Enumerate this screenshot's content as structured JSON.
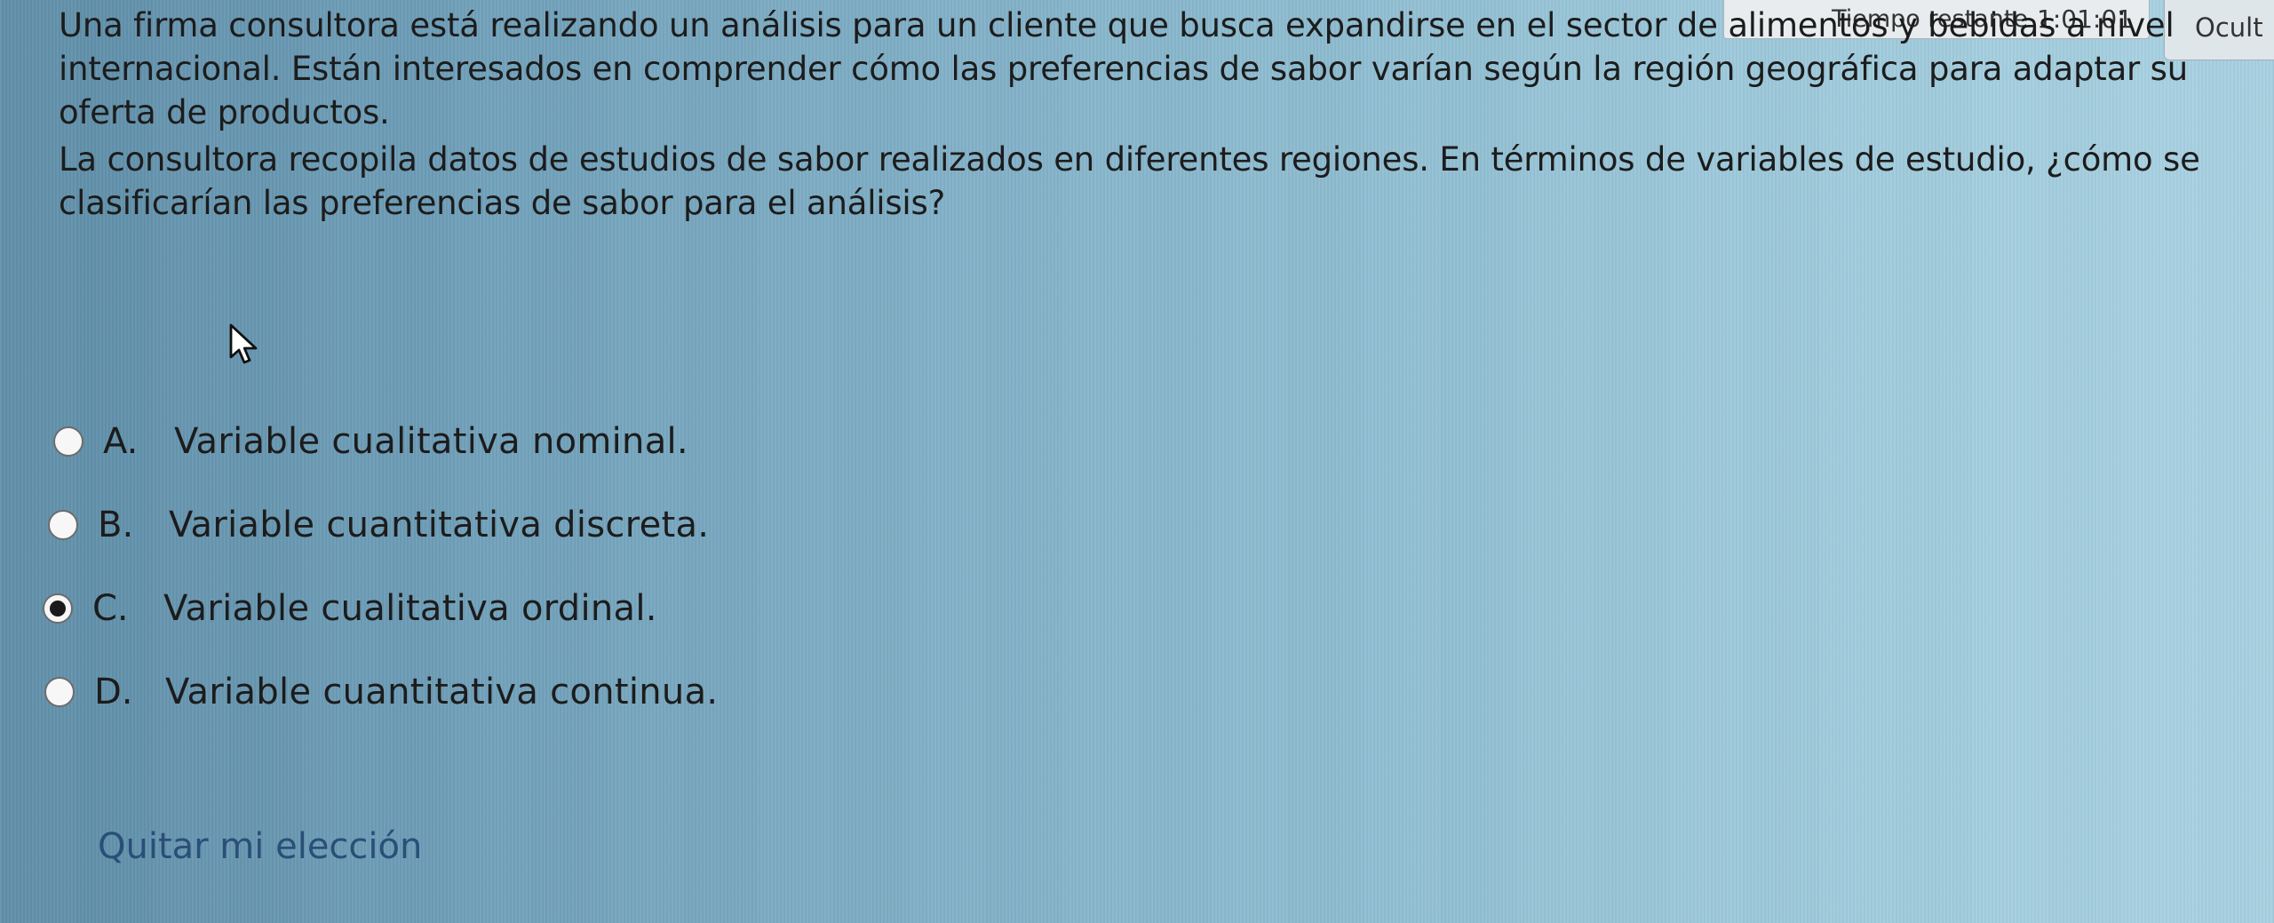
{
  "timer": {
    "label": "Tiempo restante",
    "value": "1:01:01"
  },
  "hide_label": "Ocult",
  "question": {
    "paragraph_1": "Una firma consultora está realizando un análisis para un cliente que busca expandirse en el sector de alimentos y bebidas a nivel internacional. Están interesados en comprender cómo las preferencias de sabor varían según la región geográfica para adaptar su oferta de productos.",
    "paragraph_2": "La consultora recopila datos de estudios de sabor realizados en diferentes regiones. En términos de variables de estudio, ¿cómo se clasificarían las preferencias de sabor para el análisis?"
  },
  "options": [
    {
      "letter": "A.",
      "text": "Variable cualitativa nominal.",
      "selected": false
    },
    {
      "letter": "B.",
      "text": "Variable cuantitativa discreta.",
      "selected": false
    },
    {
      "letter": "C.",
      "text": "Variable cualitativa ordinal.",
      "selected": true
    },
    {
      "letter": "D.",
      "text": "Variable cuantitativa continua.",
      "selected": false
    }
  ],
  "clear_choice_label": "Quitar mi elección",
  "icons": {
    "cursor": "mouse-pointer-icon"
  },
  "colors": {
    "link": "#2a4f77",
    "background_left": "#5f8ea8",
    "background_right": "#a9d2e2"
  }
}
